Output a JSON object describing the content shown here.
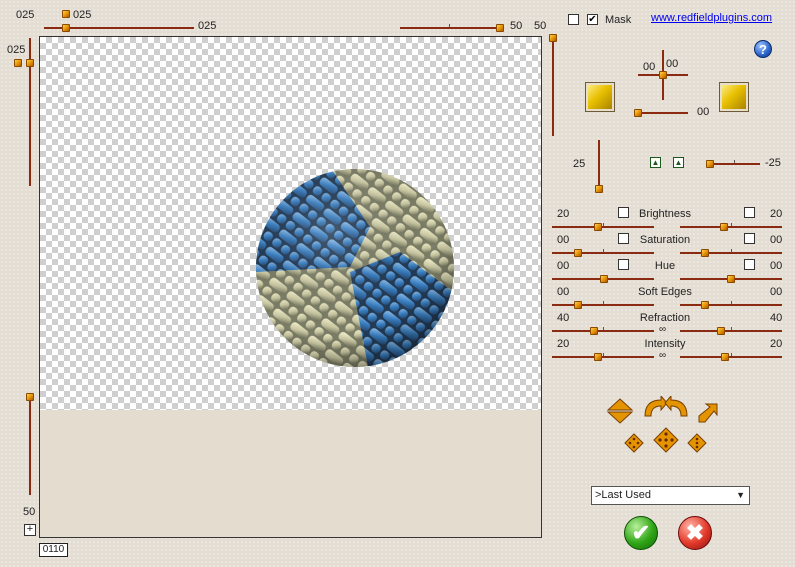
{
  "top": {
    "left_value": "025",
    "mid_value": "025",
    "mid_value2": "025",
    "right_value": "50",
    "right_value2": "50",
    "mask_label": "Mask",
    "mask_checked": true,
    "link_text": "www.redfieldplugins.com"
  },
  "left_panel": {
    "top_value": "025",
    "bottom_value": "50",
    "counter": "0110"
  },
  "right_panel": {
    "help_label": "?",
    "pad_x": "00",
    "pad_y": "00",
    "pad_bottom": "00",
    "depth_value": "25",
    "tilt_value": "-25",
    "sliders": [
      {
        "label": "Brightness",
        "left": "20",
        "right": "20"
      },
      {
        "label": "Saturation",
        "left": "00",
        "right": "00"
      },
      {
        "label": "Hue",
        "left": "00",
        "right": "00"
      },
      {
        "label": "Soft Edges",
        "left": "00",
        "right": "00"
      },
      {
        "label": "Refraction",
        "left": "40",
        "right": "40"
      },
      {
        "label": "Intensity",
        "left": "20",
        "right": "20"
      }
    ],
    "preset": ">Last Used",
    "ok_label": "✔",
    "cancel_label": "✖"
  },
  "icons": {
    "help": "help-icon",
    "ok": "ok-icon",
    "cancel": "cancel-icon"
  },
  "colors": {
    "track": "#8a2a10",
    "knob": "#f0a000",
    "ok": "#2fa516",
    "cancel": "#e23a2a"
  }
}
